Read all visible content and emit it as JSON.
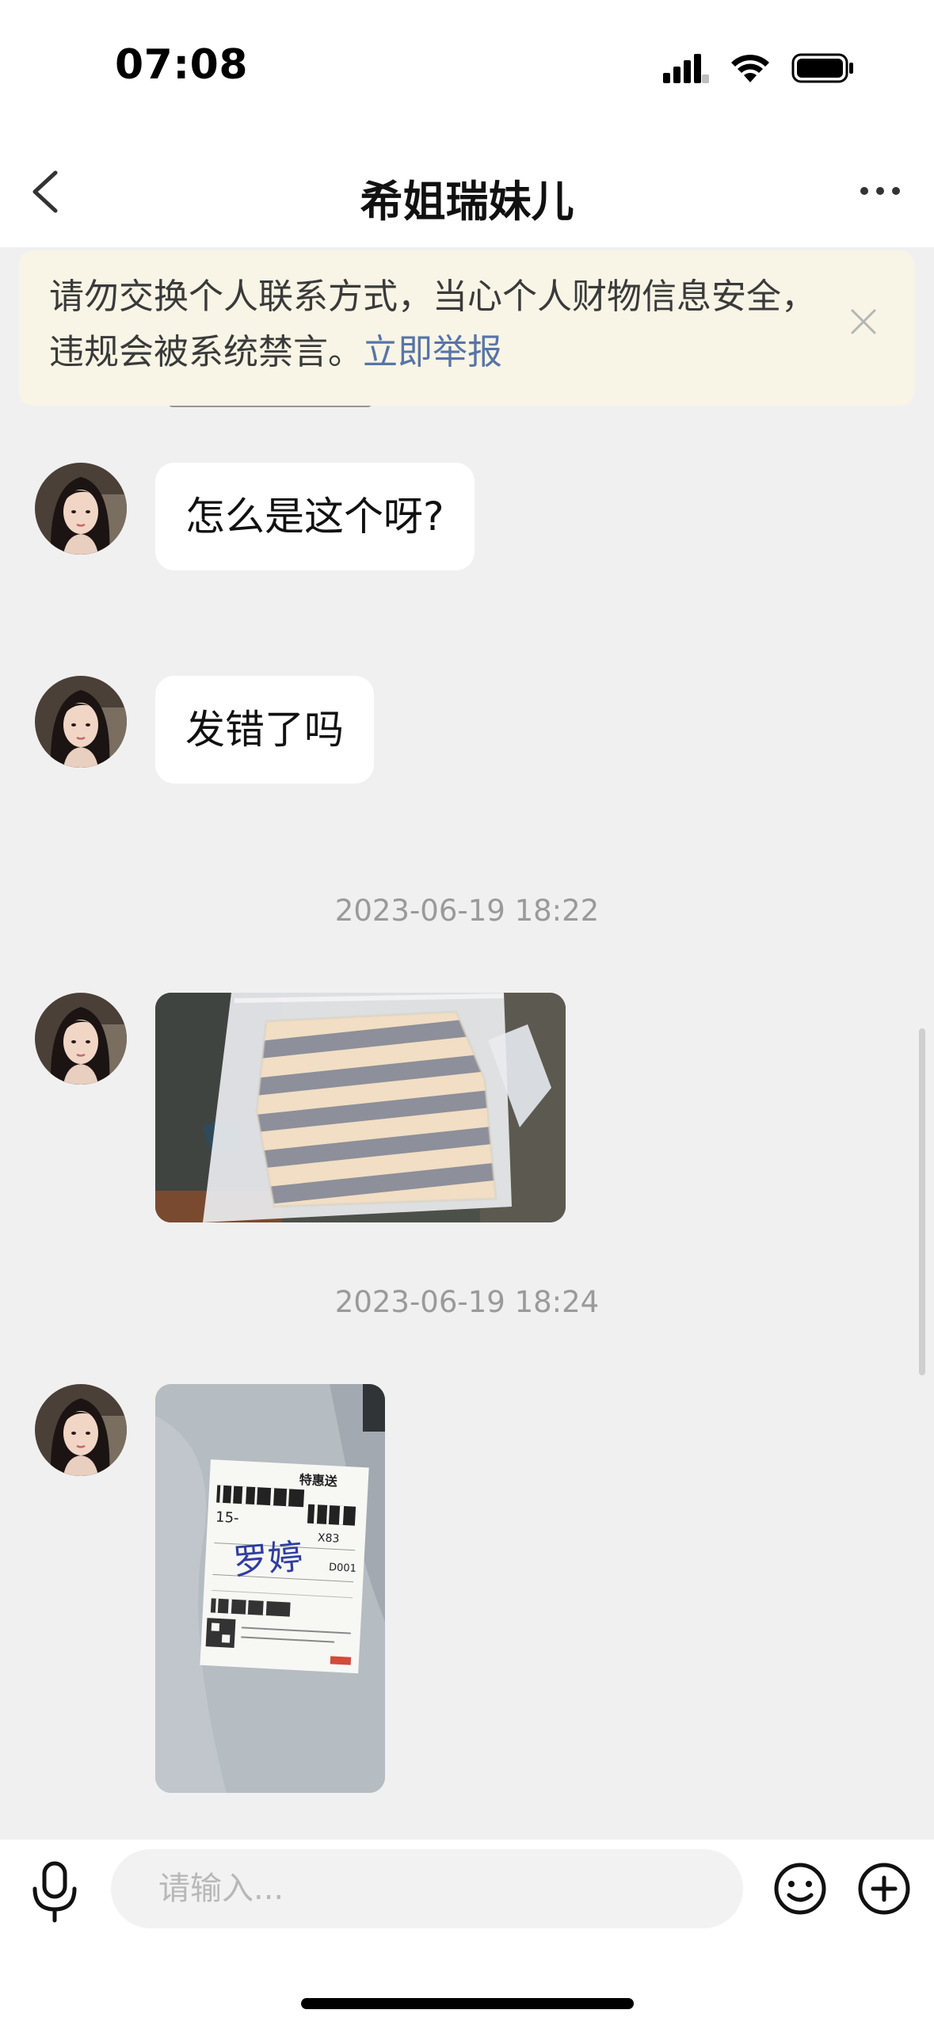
{
  "status_bar": {
    "time": "07:08"
  },
  "nav": {
    "title": "希姐瑞妹儿"
  },
  "warning": {
    "text": "请勿交换个人联系方式，当心个人财物信息安全，违规会被系统禁言。",
    "link_label": "立即举报"
  },
  "messages": [
    {
      "type": "text",
      "text": "怎么是这个呀?"
    },
    {
      "type": "text",
      "text": "发错了吗"
    },
    {
      "type": "timestamp",
      "text": "2023-06-19 18:22"
    },
    {
      "type": "image",
      "content": "photo of a striped knit sweater in a plastic bag"
    },
    {
      "type": "timestamp",
      "text": "2023-06-19 18:24"
    },
    {
      "type": "image",
      "content": "photo of a package with shipping label"
    }
  ],
  "shipping_label": {
    "brand": "特惠送",
    "code": "15-",
    "route": "X83",
    "seq": "D001",
    "handwritten": "罗婷"
  },
  "input": {
    "placeholder": "请输入..."
  },
  "icons": {
    "back": "chevron-left-icon",
    "more": "more-dots-icon",
    "close": "close-icon",
    "mic": "microphone-icon",
    "emoji": "emoji-icon",
    "plus": "plus-circle-icon"
  },
  "colors": {
    "link": "#5874a8",
    "banner_bg": "#f8f5e6",
    "chat_bg": "#f0f0f0"
  }
}
